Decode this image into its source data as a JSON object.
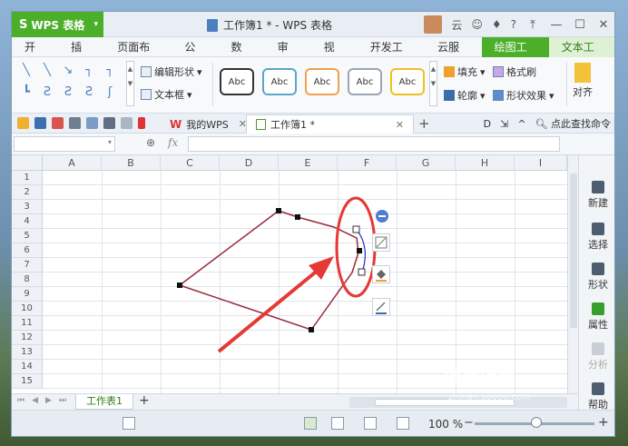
{
  "app": {
    "name": "WPS 表格",
    "document_title": "工作簿1 * - WPS 表格",
    "user_label": "云"
  },
  "ribbon_tabs": [
    {
      "label": "开始"
    },
    {
      "label": "插入"
    },
    {
      "label": "页面布局"
    },
    {
      "label": "公式"
    },
    {
      "label": "数据"
    },
    {
      "label": "审阅"
    },
    {
      "label": "视图"
    },
    {
      "label": "开发工具"
    },
    {
      "label": "云服务"
    },
    {
      "label": "绘图工具",
      "active": true
    },
    {
      "label": "文本工具"
    }
  ],
  "ribbon": {
    "edit_shape": "编辑形状",
    "text_box": "文本框",
    "style_label": "Abc",
    "style_colors": [
      "#333333",
      "#5aa6c8",
      "#f0a050",
      "#9aa6b3",
      "#f0c020"
    ],
    "fill": "填充",
    "format_painter": "格式刷",
    "outline": "轮廓",
    "shape_effect": "形状效果",
    "align": "对齐"
  },
  "doc_tabs": {
    "my_wps": "我的WPS",
    "workbook": "工作簿1 *",
    "find_command": "点此查找命令"
  },
  "formula_bar": {
    "fx": "fx"
  },
  "columns": [
    "A",
    "B",
    "C",
    "D",
    "E",
    "F",
    "G",
    "H",
    "I"
  ],
  "rows": [
    "1",
    "2",
    "3",
    "4",
    "5",
    "6",
    "7",
    "8",
    "9",
    "10",
    "11",
    "12",
    "13",
    "14",
    "15"
  ],
  "task_pane": [
    {
      "label": "新建"
    },
    {
      "label": "选择"
    },
    {
      "label": "形状"
    },
    {
      "label": "属性",
      "selected": true
    },
    {
      "label": "分析",
      "disabled": true
    },
    {
      "label": "帮助"
    }
  ],
  "sheet_tabs": [
    {
      "label": "工作表1"
    }
  ],
  "status": {
    "zoom": "100 %"
  },
  "colors": {
    "accent": "#4caf2a",
    "shape_stroke": "#9a2a3a",
    "annotation_red": "#e53935"
  },
  "watermark": {
    "text": "搜狗指南",
    "url": "zhinan.sogou.com"
  }
}
